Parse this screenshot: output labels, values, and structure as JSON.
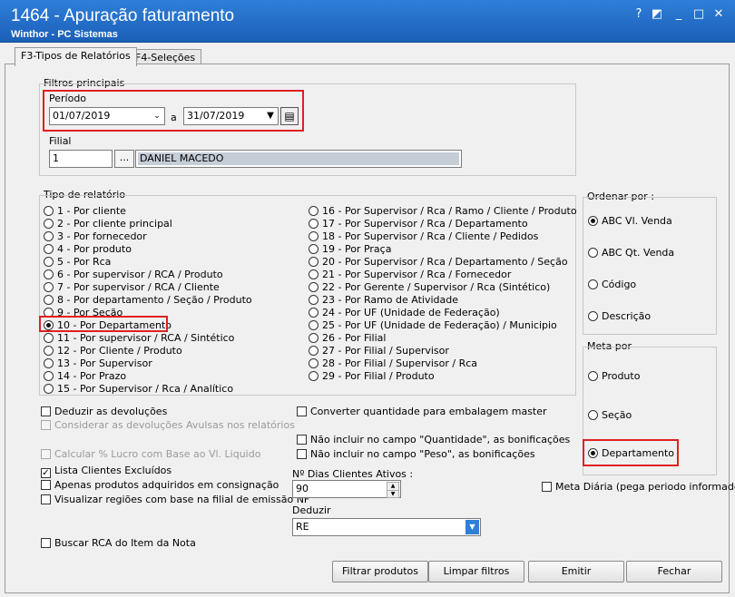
{
  "window": {
    "title": "1464 - Apuração faturamento",
    "subtitle": "Winthor - PC Sistemas",
    "controls": [
      "?",
      "◩",
      "_",
      "□",
      "✕"
    ]
  },
  "tabs": [
    {
      "label": "F3-Tipos de Relatórios"
    },
    {
      "label": "F4-Seleções"
    }
  ],
  "filtros": {
    "group_label": "Filtros principais",
    "periodo_label": "Período",
    "date_from": "01/07/2019",
    "date_sep": "a",
    "date_to": "31/07/2019",
    "filial_label": "Filial",
    "filial_code": "1",
    "filial_btn": "...",
    "filial_name": "DANIEL MACEDO"
  },
  "tipo": {
    "group_label": "Tipo de relatório",
    "col1": [
      "1 - Por cliente",
      "2 - Por cliente principal",
      "3 - Por fornecedor",
      "4 - Por produto",
      "5 - Por Rca",
      "6 - Por supervisor / RCA / Produto",
      "7 - Por supervisor / RCA / Cliente",
      "8 - Por departamento / Seção / Produto",
      "9 - Por Seção",
      "10 - Por Departamento",
      "11 - Por supervisor / RCA / Sintético",
      "12 - Por Cliente / Produto",
      "13 - Por Supervisor",
      "14 - Por Prazo",
      "15 - Por Supervisor / Rca / Analítico"
    ],
    "col2": [
      "16 - Por Supervisor / Rca / Ramo /  Cliente / Produto",
      "17 - Por Supervisor / Rca / Departamento",
      "18 - Por Supervisor / Rca / Cliente / Pedidos",
      "19 - Por Praça",
      "20 - Por Supervisor / Rca / Departamento / Seção",
      "21 - Por Supervisor / Rca / Fornecedor",
      "22 - Por Gerente / Supervisor / Rca (Sintético)",
      "23 - Por Ramo de Atividade",
      "24 - Por UF (Unidade de Federação)",
      "25 - Por UF (Unidade de Federação) / Municipio",
      "26 - Por Filial",
      "27 - Por Filial / Supervisor",
      "28 - Por Filial / Supervisor / Rca",
      "29 - Por Filial / Produto"
    ],
    "selected": "10 - Por Departamento"
  },
  "ordenar": {
    "group_label": "Ordenar por :",
    "options": [
      "ABC Vl. Venda",
      "ABC Qt. Venda",
      "Código",
      "Descrição"
    ],
    "selected": "ABC Vl. Venda"
  },
  "meta": {
    "group_label": "Meta por",
    "options": [
      "Produto",
      "Seção",
      "Departamento"
    ],
    "selected": "Departamento"
  },
  "checks_left": [
    {
      "label": "Deduzir as devoluções",
      "checked": false,
      "disabled": false
    },
    {
      "label": "Considerar as devoluções Avulsas nos relatórios",
      "checked": false,
      "disabled": true
    },
    {
      "label": "Calcular % Lucro com Base ao Vl. Liquido",
      "checked": false,
      "disabled": true
    },
    {
      "label": "Lista Clientes Excluídos",
      "checked": true,
      "disabled": false
    },
    {
      "label": "Apenas produtos adquiridos em consignação",
      "checked": false,
      "disabled": false
    },
    {
      "label": "Visualizar regiões com base na filial de emissão NF",
      "checked": false,
      "disabled": false
    },
    {
      "label": "Buscar RCA do Item da Nota",
      "checked": false,
      "disabled": false
    }
  ],
  "checks_mid": [
    {
      "label": "Converter quantidade para embalagem master",
      "checked": false
    },
    {
      "label": "Não incluir no campo \"Quantidade\", as bonificações",
      "checked": false
    },
    {
      "label": "Não incluir no campo \"Peso\", as bonificações",
      "checked": false
    }
  ],
  "meta_diaria": {
    "label": "Meta Diária (pega periodo informado)",
    "checked": false
  },
  "dias": {
    "label": "Nº Dias Clientes Ativos :",
    "value": "90"
  },
  "deduzir": {
    "label": "Deduzir",
    "value": "RE"
  },
  "buttons": {
    "filtrar": "Filtrar produtos",
    "limpar": "Limpar filtros",
    "emitir": "Emitir",
    "fechar": "Fechar"
  }
}
